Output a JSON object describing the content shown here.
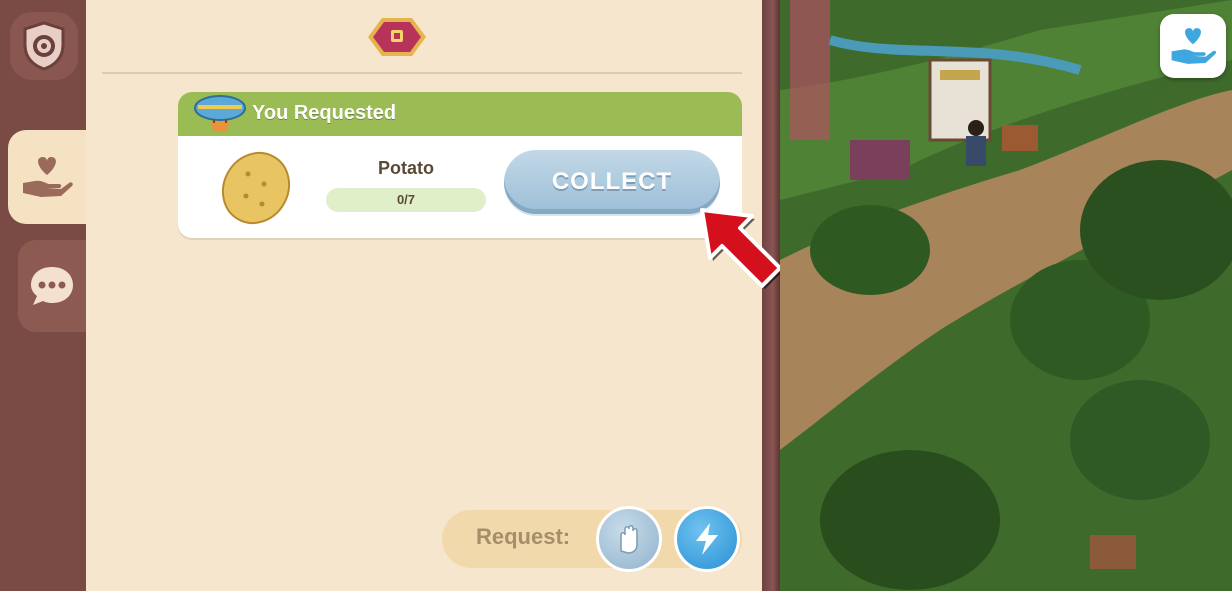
{
  "request_card": {
    "title": "You Requested",
    "item_name": "Potato",
    "progress_text": "0/7",
    "progress_fraction": 0,
    "collect_label": "COLLECT"
  },
  "request_bar": {
    "label": "Request:"
  },
  "icons": {
    "settings": "settings-shield-icon",
    "guild": "heart-hand-icon",
    "chat": "chat-bubble-icon",
    "badge": "guild-badge-icon",
    "blimp": "blimp-icon",
    "potato": "potato-icon",
    "pointer": "red-arrow-icon",
    "hand_request": "hand-request-icon",
    "energy_request": "lightning-icon",
    "help": "heart-hand-help-icon"
  },
  "colors": {
    "header_green": "#9bbb55",
    "panel_bg": "#f5e6cd",
    "sidebar": "#7a4a45",
    "collect_button": "#a9c8de",
    "arrow_red": "#d4101c"
  }
}
